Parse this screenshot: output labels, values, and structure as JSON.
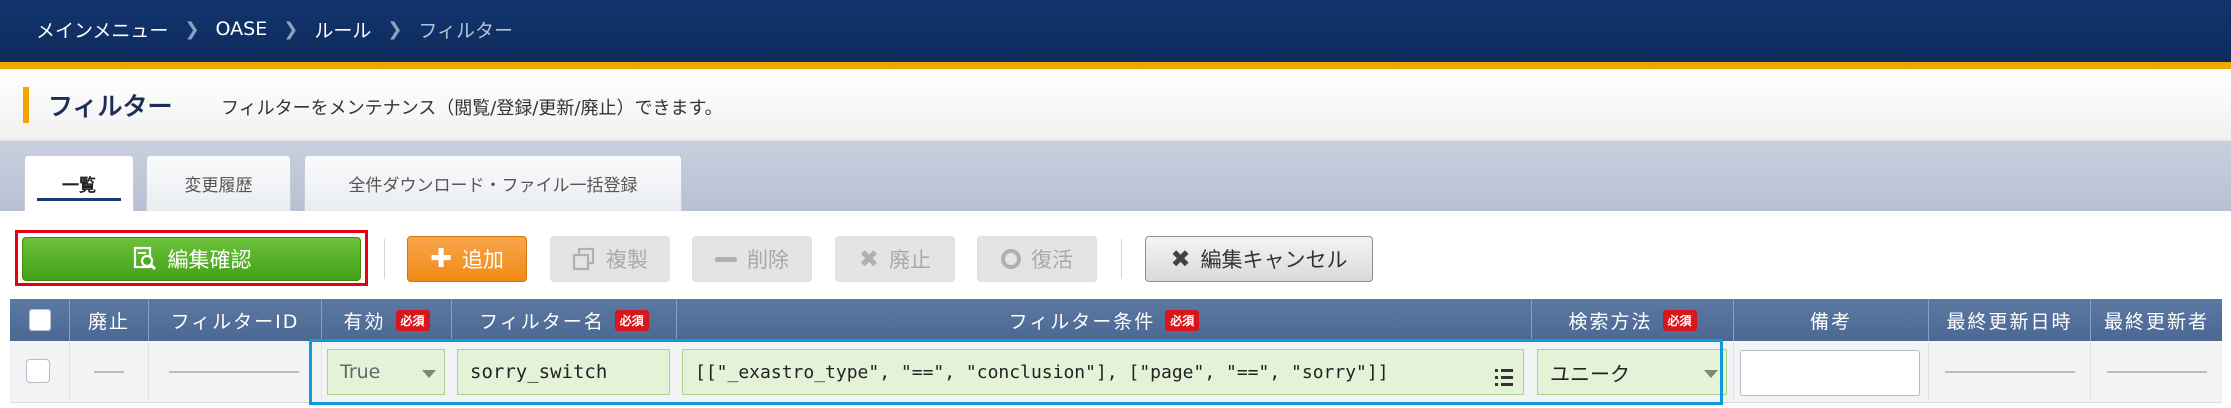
{
  "breadcrumb": [
    "メインメニュー",
    "OASE",
    "ルール",
    "フィルター"
  ],
  "page": {
    "title": "フィルター",
    "description": "フィルターをメンテナンス（閲覧/登録/更新/廃止）できます。"
  },
  "tabs": [
    {
      "label": "一覧",
      "active": true
    },
    {
      "label": "変更履歴",
      "active": false
    },
    {
      "label": "全件ダウンロード・ファイル一括登録",
      "active": false
    }
  ],
  "toolbar": {
    "edit_confirm": "編集確認",
    "add": "追加",
    "duplicate": "複製",
    "delete": "削除",
    "discard": "廃止",
    "restore": "復活",
    "edit_cancel": "編集キャンセル"
  },
  "grid": {
    "required_badge": "必須",
    "columns": [
      "",
      "廃止",
      "フィルターID",
      "有効",
      "フィルター名",
      "フィルター条件",
      "検索方法",
      "備考",
      "最終更新日時",
      "最終更新者"
    ],
    "row": {
      "enabled": "True",
      "filter_name": "sorry_switch",
      "filter_condition": "[[\"_exastro_type\", \"==\", \"conclusion\"], [\"page\", \"==\", \"sorry\"]]",
      "search_method": "ユニーク",
      "remarks": ""
    }
  },
  "colors": {
    "header_bg": "#0d2b5c",
    "accent_stripe": "#f0a800",
    "confirm_green": "#44a118",
    "add_orange": "#f18a16",
    "required_red": "#d8161b",
    "highlight_red": "#e60012",
    "highlight_blue": "#0f9ad9"
  },
  "icons": {
    "edit_confirm": "search-document-icon",
    "add": "plus-icon",
    "duplicate": "copy-icon",
    "delete": "minus-icon",
    "discard": "x-icon",
    "restore": "circle-icon",
    "edit_cancel": "x-icon",
    "condition_editor": "list-icon"
  }
}
